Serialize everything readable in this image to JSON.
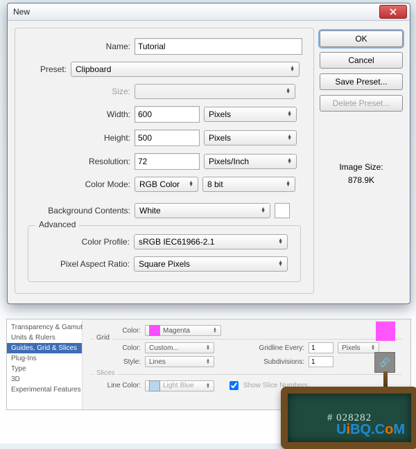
{
  "dialog": {
    "title": "New",
    "name_label": "Name:",
    "name_value": "Tutorial",
    "preset_label": "Preset:",
    "preset_value": "Clipboard",
    "size_label": "Size:",
    "size_value": "",
    "width_label": "Width:",
    "width_value": "600",
    "width_unit": "Pixels",
    "height_label": "Height:",
    "height_value": "500",
    "height_unit": "Pixels",
    "resolution_label": "Resolution:",
    "resolution_value": "72",
    "resolution_unit": "Pixels/Inch",
    "colormode_label": "Color Mode:",
    "colormode_value": "RGB Color",
    "colormode_depth": "8 bit",
    "bgcontents_label": "Background Contents:",
    "bgcontents_value": "White",
    "advanced_legend": "Advanced",
    "colorprofile_label": "Color Profile:",
    "colorprofile_value": "sRGB IEC61966-2.1",
    "pixelaspect_label": "Pixel Aspect Ratio:",
    "pixelaspect_value": "Square Pixels"
  },
  "buttons": {
    "ok": "OK",
    "cancel": "Cancel",
    "save_preset": "Save Preset...",
    "delete_preset": "Delete Preset..."
  },
  "imagesize": {
    "label": "Image Size:",
    "value": "878.9K"
  },
  "prefs": {
    "side": [
      "Transparency & Gamut",
      "Units & Rulers",
      "Guides, Grid & Slices",
      "Plug-Ins",
      "Type",
      "3D",
      "Experimental Features"
    ],
    "selected_index": 2,
    "top_color_label": "Color:",
    "top_color_value": "Magenta",
    "grid_legend": "Grid",
    "grid_color_label": "Color:",
    "grid_color_value": "Custom...",
    "grid_style_label": "Style:",
    "grid_style_value": "Lines",
    "gridline_every_label": "Gridline Every:",
    "gridline_every_value": "1",
    "gridline_every_unit": "Pixels",
    "subdivisions_label": "Subdivisions:",
    "subdivisions_value": "1",
    "slices_legend": "Slices",
    "slices_linecolor_label": "Line Color:",
    "slices_linecolor_value": "Light Blue",
    "slices_shownum_label": "Show Slice Numbers"
  },
  "board_text": "# 028282",
  "watermark": {
    "a": "U",
    "b": "i",
    "c": "BQ.C",
    "d": "o",
    "e": "M"
  }
}
